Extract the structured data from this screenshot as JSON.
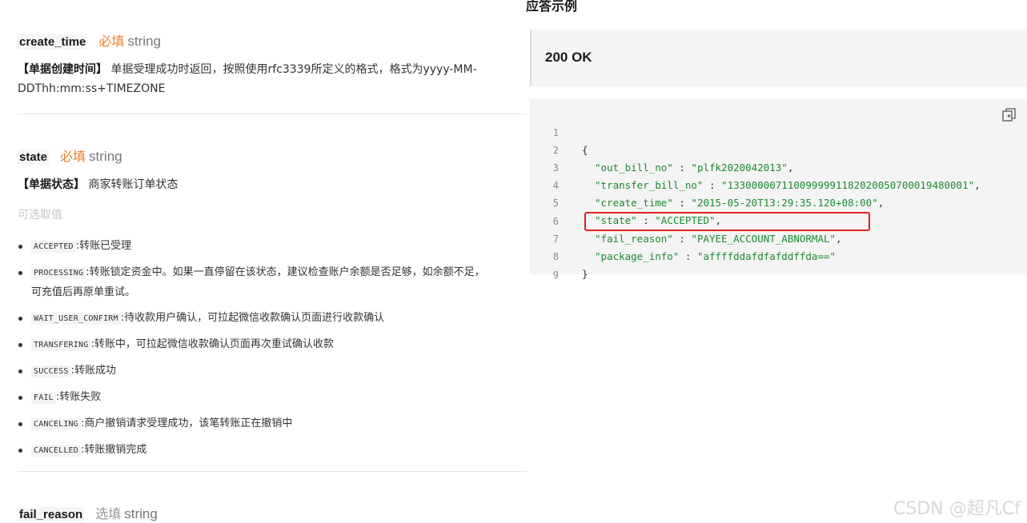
{
  "params": {
    "create_time": {
      "name": "create_time",
      "required": "必填",
      "type": "string",
      "tag": "【单据创建时间】",
      "desc_line1": "单据受理成功时返回，按照使用rfc3339所定义的格式，格式为yyyy-MM-",
      "desc_line2": "DDThh:mm:ss+TIMEZONE"
    },
    "state": {
      "name": "state",
      "required": "必填",
      "type": "string",
      "tag": "【单据状态】",
      "desc": "商家转账订单状态",
      "optional_values_label": "可选取值",
      "values": [
        {
          "code": "ACCEPTED",
          "sep": ":",
          "text": "转账已受理"
        },
        {
          "code": "PROCESSING",
          "sep": ":",
          "text": "转账锁定资金中。如果一直停留在该状态，建议检查账户余额是否足够，如余额不足，",
          "text2": "可充值后再原单重试。"
        },
        {
          "code": "WAIT_USER_CONFIRM",
          "sep": ":",
          "text": "待收款用户确认，可拉起微信收款确认页面进行收款确认"
        },
        {
          "code": "TRANSFERING",
          "sep": ":",
          "text": "转账中，可拉起微信收款确认页面再次重试确认收款"
        },
        {
          "code": "SUCCESS",
          "sep": ":",
          "text": "转账成功"
        },
        {
          "code": "FAIL",
          "sep": ":",
          "text": "转账失败"
        },
        {
          "code": "CANCELING",
          "sep": ":",
          "text": "商户撤销请求受理成功，该笔转账正在撤销中"
        },
        {
          "code": "CANCELLED",
          "sep": ":",
          "text": "转账撤销完成"
        }
      ]
    },
    "fail_reason": {
      "name": "fail_reason",
      "optional": "选填",
      "type": "string"
    }
  },
  "response": {
    "title": "应答示例",
    "status": "200 OK",
    "code_lines": [
      {
        "n": "1",
        "open": "{"
      },
      {
        "n": "2",
        "key": "\"out_bill_no\"",
        "colon": " : ",
        "val": "\"plfk2020042013\"",
        "comma": ","
      },
      {
        "n": "3",
        "key": "\"transfer_bill_no\"",
        "colon": " : ",
        "val": "\"1330000071100999991182020050700019480001\"",
        "comma": ","
      },
      {
        "n": "4",
        "key": "\"create_time\"",
        "colon": " : ",
        "val": "\"2015-05-20T13:29:35.120+08:00\"",
        "comma": ","
      },
      {
        "n": "5",
        "key": "\"state\"",
        "colon": " : ",
        "val": "\"ACCEPTED\"",
        "comma": ","
      },
      {
        "n": "6",
        "key": "\"fail_reason\"",
        "colon": " : ",
        "val": "\"PAYEE_ACCOUNT_ABNORMAL\"",
        "comma": ","
      },
      {
        "n": "7",
        "key": "\"package_info\"",
        "colon": " : ",
        "val": "\"affffddafdfafddffda==\"",
        "comma": ""
      },
      {
        "n": "8",
        "open": "}"
      },
      {
        "n": "9",
        "open": ""
      }
    ],
    "copy_icon": "copy-icon",
    "highlight_color": "#e02020"
  },
  "watermark": "CSDN @超凡Cf"
}
